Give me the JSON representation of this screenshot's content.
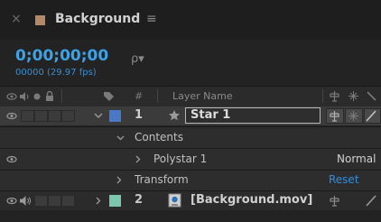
{
  "panel": {
    "close_glyph": "×",
    "title": "Background",
    "menu_glyph": "≡",
    "label_color": "#b38a67"
  },
  "timecode": {
    "value": "0;00;00;00",
    "frames": "00000 (29.97 fps)"
  },
  "search": {
    "glyph": "ρ▾"
  },
  "columns": {
    "hash": "#",
    "layer_name": "Layer Name"
  },
  "layers": [
    {
      "number": "1",
      "name": "Star 1",
      "label_color": "#4a78c8",
      "type_icon": "star"
    },
    {
      "number": "2",
      "name": "[Background.mov]",
      "label_color": "#7cc6b0",
      "type_icon": "footage"
    }
  ],
  "properties": {
    "contents": "Contents",
    "polystar": "Polystar 1",
    "polystar_mode": "Normal",
    "transform": "Transform",
    "transform_action": "Reset"
  },
  "colors": {
    "accent": "#3ba3e6",
    "link": "#2e8fe0",
    "text": "#c8c8c8"
  }
}
